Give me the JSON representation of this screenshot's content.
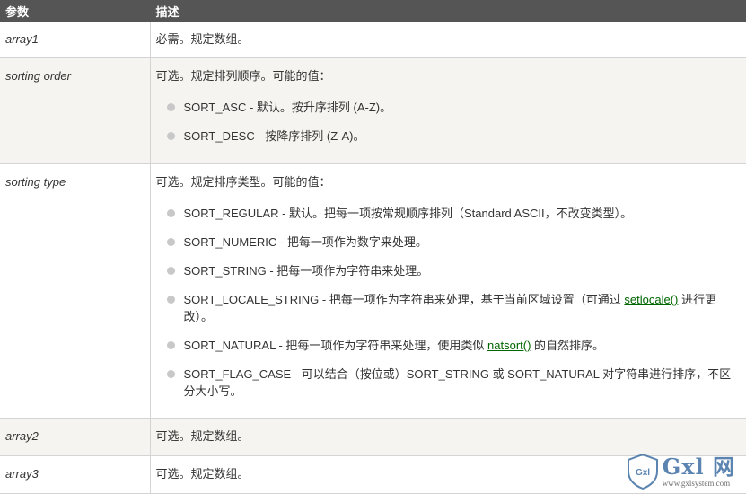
{
  "table": {
    "headers": {
      "param": "参数",
      "desc": "描述"
    },
    "rows": [
      {
        "name": "array1",
        "desc": "必需。规定数组。"
      },
      {
        "name": "sorting order",
        "desc": "可选。规定排列顺序。可能的值：",
        "options": [
          "SORT_ASC - 默认。按升序排列 (A-Z)。",
          "SORT_DESC - 按降序排列 (Z-A)。"
        ]
      },
      {
        "name": "sorting type",
        "desc": "可选。规定排序类型。可能的值：",
        "options": [
          {
            "text": "SORT_REGULAR - 默认。把每一项按常规顺序排列（Standard ASCII，不改变类型）。"
          },
          {
            "text": "SORT_NUMERIC - 把每一项作为数字来处理。"
          },
          {
            "text": "SORT_STRING - 把每一项作为字符串来处理。"
          },
          {
            "before": "SORT_LOCALE_STRING - 把每一项作为字符串来处理，基于当前区域设置（可通过 ",
            "link": "setlocale()",
            "after": " 进行更改）。"
          },
          {
            "before": "SORT_NATURAL - 把每一项作为字符串来处理，使用类似 ",
            "link": "natsort()",
            "after": " 的自然排序。"
          },
          {
            "text": "SORT_FLAG_CASE - 可以结合（按位或）SORT_STRING 或 SORT_NATURAL 对字符串进行排序，不区分大小写。"
          }
        ]
      },
      {
        "name": "array2",
        "desc": "可选。规定数组。"
      },
      {
        "name": "array3",
        "desc": "可选。规定数组。"
      }
    ]
  },
  "watermark": {
    "shield_text": "Gxl",
    "title": "Gxl 网",
    "url": "www.gxlsystem.com"
  },
  "colors": {
    "header_bg": "#555555",
    "alt_row_bg": "#f6f4f0",
    "link": "#006600",
    "bullet": "#c8c8c8",
    "watermark": "#3f6fa3"
  }
}
